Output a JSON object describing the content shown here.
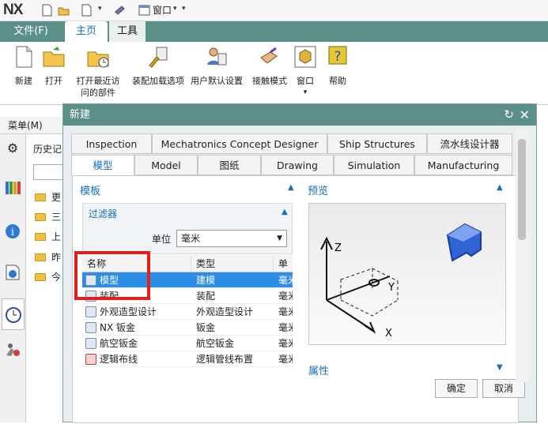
{
  "app": {
    "logo": "NX",
    "window_menu": "窗口"
  },
  "ribbon": {
    "tabs": {
      "file": "文件(F)",
      "home": "主页",
      "tools": "工具"
    },
    "buttons": {
      "new": "新建",
      "open": "打开",
      "open_recent_1": "打开最近访",
      "open_recent_2": "问的部件",
      "assembly_load": "装配加载选项",
      "user_defaults": "用户默认设置",
      "touch_mode": "接触模式",
      "window": "窗口",
      "help": "帮助"
    }
  },
  "left": {
    "menu": "菜单(M)",
    "history_label": "历史记",
    "folders": [
      "更",
      "三",
      "上",
      "昨",
      "今"
    ]
  },
  "dialog": {
    "title": "新建",
    "tabs_row1": [
      "Inspection",
      "Mechatronics Concept Designer",
      "Ship Structures",
      "流水线设计器"
    ],
    "tabs_row2": [
      "模型",
      "Model",
      "图纸",
      "Drawing",
      "Simulation",
      "Manufacturing"
    ],
    "selected_tab": "模型",
    "template_section": "模板",
    "preview_section": "预览",
    "properties_section": "属性",
    "filter": {
      "title": "过滤器",
      "unit_label": "单位",
      "unit_value": "毫米"
    },
    "columns": [
      "名称",
      "类型",
      "单位"
    ],
    "rows": [
      {
        "name": "模型",
        "type": "建模",
        "unit": "毫米"
      },
      {
        "name": "装配",
        "type": "装配",
        "unit": "毫米"
      },
      {
        "name": "外观造型设计",
        "type": "外观造型设计",
        "unit": "毫米"
      },
      {
        "name": "NX 钣金",
        "type": "钣金",
        "unit": "毫米"
      },
      {
        "name": "航空钣金",
        "type": "航空钣金",
        "unit": "毫米"
      },
      {
        "name": "逻辑布线",
        "type": "逻辑管线布置",
        "unit": "毫米"
      }
    ],
    "axes": {
      "z": "Z",
      "y": "Y",
      "x": "X"
    },
    "ok": "确定",
    "cancel": "取消"
  },
  "colors": {
    "accent": "#5b8f87",
    "selection": "#2d8ce6",
    "highlight_box": "#e0201a"
  }
}
